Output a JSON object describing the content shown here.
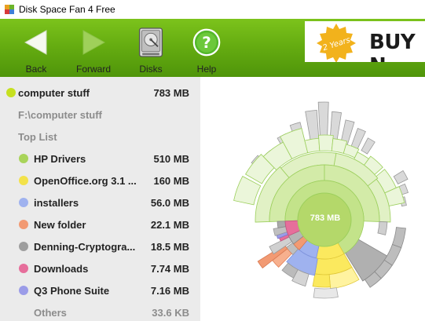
{
  "window": {
    "title": "Disk Space Fan 4 Free"
  },
  "toolbar": {
    "back": "Back",
    "forward": "Forward",
    "disks": "Disks",
    "help": "Help"
  },
  "banner": {
    "badge": "2 Years",
    "text": "BUY N"
  },
  "sidebar": {
    "root": {
      "name": "computer stuff",
      "size": "783 MB",
      "color": "#c6e020"
    },
    "path": "F:\\computer stuff",
    "top_list_label": "Top List",
    "items": [
      {
        "name": "HP Drivers",
        "size": "510 MB",
        "color": "#a9d45a"
      },
      {
        "name": "OpenOffice.org 3.1 ...",
        "size": "160 MB",
        "color": "#f3e24a"
      },
      {
        "name": "installers",
        "size": "56.0 MB",
        "color": "#9fb2ef"
      },
      {
        "name": "New folder",
        "size": "22.1 MB",
        "color": "#f29a73"
      },
      {
        "name": "Denning-Cryptogra...",
        "size": "18.5 MB",
        "color": "#9e9e9e"
      },
      {
        "name": "Downloads",
        "size": "7.74 MB",
        "color": "#e66e9b"
      },
      {
        "name": "Q3 Phone Suite",
        "size": "7.16 MB",
        "color": "#9b9ce8"
      }
    ],
    "others": {
      "name": "Others",
      "size": "33.6 KB"
    }
  },
  "fan": {
    "center_label": "783 MB"
  }
}
